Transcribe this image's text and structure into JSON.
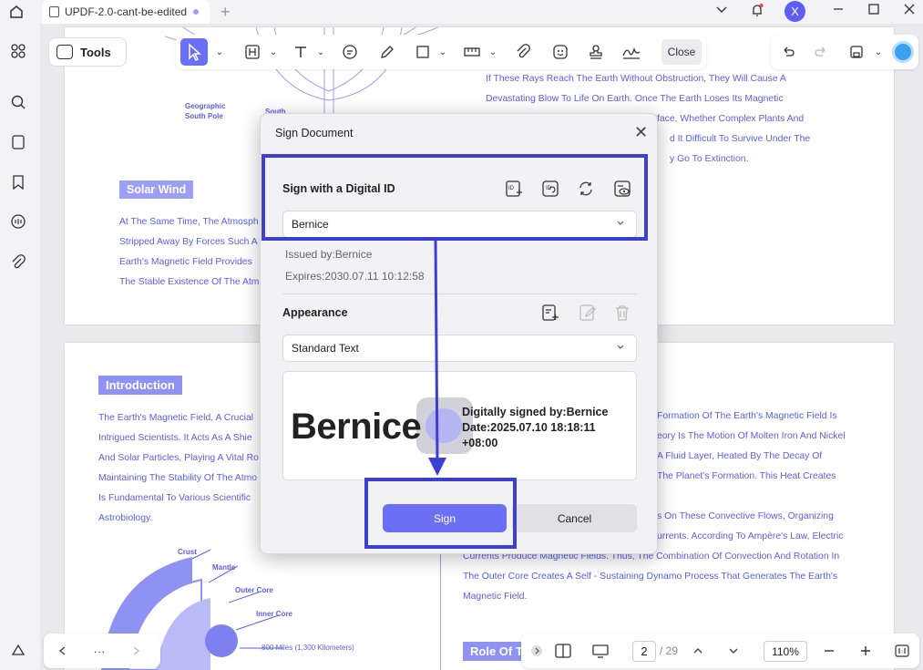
{
  "titlebar": {
    "tab_title": "UPDF-2.0-cant-be-edited",
    "add_tab": "+",
    "avatar_initial": "X"
  },
  "toolbar": {
    "tools_label": "Tools",
    "close_label": "Close"
  },
  "document": {
    "page1": {
      "diagram_label_1": "Geographic",
      "diagram_label_1b": "South Pole",
      "diagram_label_2": "South",
      "right_lines": [
        "If These Rays Reach The Earth Without Obstruction, They Will Cause A",
        "Devastating Blow To Life On Earth. Once The Earth Loses Its Magnetic",
        "face, Whether Complex Plants And",
        "d It Difficult To Survive Under The",
        "y Go To Extinction."
      ],
      "solar_wind_heading": "Solar Wind",
      "left_lines": [
        "At The Same Time, The Atmosph",
        "Stripped Away By Forces Such A",
        "Earth's Magnetic Field Provides",
        "The Stable Existence Of The Atm"
      ]
    },
    "page2": {
      "intro_heading": "Introduction",
      "left_lines": [
        "The Earth's Magnetic Field, A Crucial",
        "Intrigued Scientists. It Acts As A Shie",
        "And Solar Particles, Playing A Vital Ro",
        "Maintaining The Stability Of The Atmo",
        "Is Fundamental To Various Scientific",
        "Astrobiology."
      ],
      "right_lines": [
        "Formation Of The Earth's Magnetic Field Is",
        "eory Is The Motion Of Molten Iron And Nickel",
        "A Fluid Layer, Heated By The Decay Of",
        "The Planet's Formation. This Heat Creates",
        "",
        "s On These Convective Flows, Organizing",
        "urrents. According To Ampère's Law, Electric",
        "Currents Produce Magnetic Fields. Thus, The Combination Of Convection And Rotation In",
        "The Outer Core Creates A Self - Sustaining Dynamo Process That Generates The Earth's",
        "Magnetic Field."
      ],
      "diagram_labels": {
        "crust": "Crust",
        "mantle": "Mantle",
        "outer_core": "Outer Core",
        "inner_core": "Inner Core",
        "distance": "800 Miles (1,300 Kilometers)"
      },
      "role_heading": "Role Of Th"
    }
  },
  "bottom_bar": {
    "more": "···",
    "current_page": "2",
    "total_pages": "/ 29",
    "zoom": "110%"
  },
  "dialog": {
    "title": "Sign Document",
    "close_glyph": "✕",
    "digital_id": {
      "section_title": "Sign with a Digital ID",
      "selected_id": "Bernice",
      "issued_by": "Issued by:Bernice",
      "expires": "Expires:2030.07.11 10:12:58"
    },
    "appearance": {
      "section_title": "Appearance",
      "selected_style": "Standard Text",
      "preview_name": "Bernice",
      "preview_signed_by": "Digitally signed by:Bernice",
      "preview_date": "Date:2025.07.10 18:18:11",
      "preview_tz": "+08:00"
    },
    "sign_label": "Sign",
    "cancel_label": "Cancel"
  },
  "colors": {
    "accent": "#6b6ff3",
    "highlight": "#3d3fd1",
    "doc_text": "#5a5ee6"
  }
}
